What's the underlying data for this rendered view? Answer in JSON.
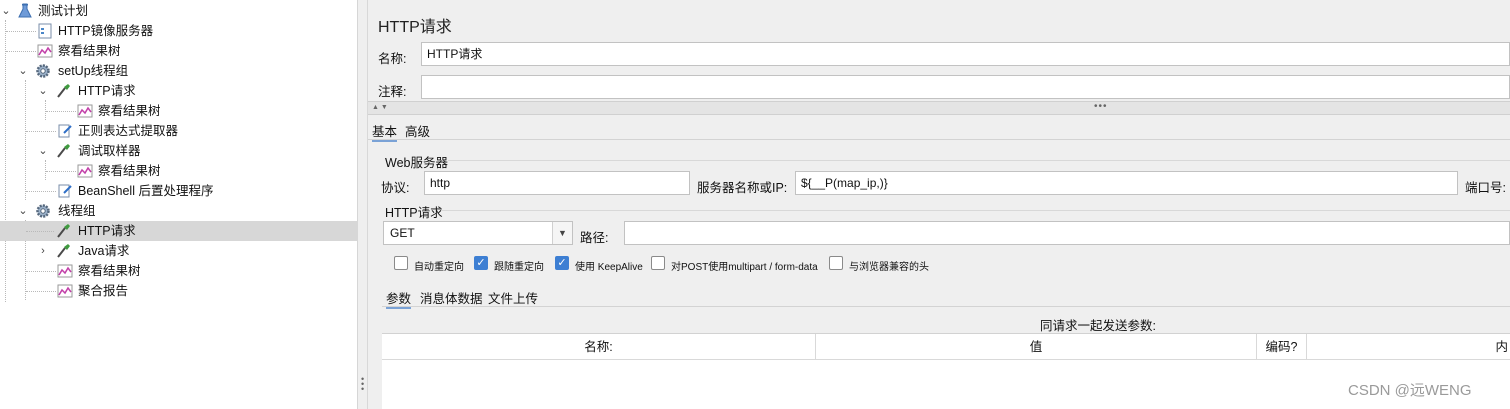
{
  "tree": {
    "items": [
      {
        "label": "测试计划",
        "icon": "test-plan-icon"
      },
      {
        "label": "HTTP镜像服务器",
        "icon": "mirror-server-icon"
      },
      {
        "label": "察看结果树",
        "icon": "result-tree-icon"
      },
      {
        "label": "setUp线程组",
        "icon": "gear-icon"
      },
      {
        "label": "HTTP请求",
        "icon": "sampler-icon"
      },
      {
        "label": "察看结果树",
        "icon": "result-tree-icon"
      },
      {
        "label": "正则表达式提取器",
        "icon": "extractor-icon"
      },
      {
        "label": "调试取样器",
        "icon": "sampler-icon"
      },
      {
        "label": "察看结果树",
        "icon": "result-tree-icon"
      },
      {
        "label": "BeanShell 后置处理程序",
        "icon": "postprocessor-icon"
      },
      {
        "label": "线程组",
        "icon": "gear-icon"
      },
      {
        "label": "HTTP请求",
        "icon": "sampler-icon"
      },
      {
        "label": "Java请求",
        "icon": "sampler-icon"
      },
      {
        "label": "察看结果树",
        "icon": "result-tree-icon"
      },
      {
        "label": "聚合报告",
        "icon": "report-icon"
      }
    ]
  },
  "panel": {
    "title": "HTTP请求",
    "name_label": "名称:",
    "name_value": "HTTP请求",
    "comment_label": "注释:",
    "comment_value": "",
    "tabs": [
      "基本",
      "高级"
    ],
    "web_server": {
      "section": "Web服务器",
      "protocol_label": "协议:",
      "protocol_value": "http",
      "server_label": "服务器名称或IP:",
      "server_value": "${__P(map_ip,)}",
      "port_label": "端口号:"
    },
    "http_request": {
      "section": "HTTP请求",
      "method": "GET",
      "path_label": "路径:",
      "path_value": ""
    },
    "checkboxes": [
      {
        "label": "自动重定向",
        "checked": false
      },
      {
        "label": "跟随重定向",
        "checked": true
      },
      {
        "label": "使用 KeepAlive",
        "checked": true
      },
      {
        "label": "对POST使用multipart / form-data",
        "checked": false
      },
      {
        "label": "与浏览器兼容的头",
        "checked": false
      }
    ],
    "sub_tabs": [
      "参数",
      "消息体数据",
      "文件上传"
    ],
    "params_title": "同请求一起发送参数:",
    "columns": [
      "名称:",
      "值",
      "编码?",
      "内"
    ]
  },
  "watermark": "CSDN @远WENG",
  "colors": {
    "accent": "#3d7fd3",
    "selection": "#d7d7d7"
  }
}
